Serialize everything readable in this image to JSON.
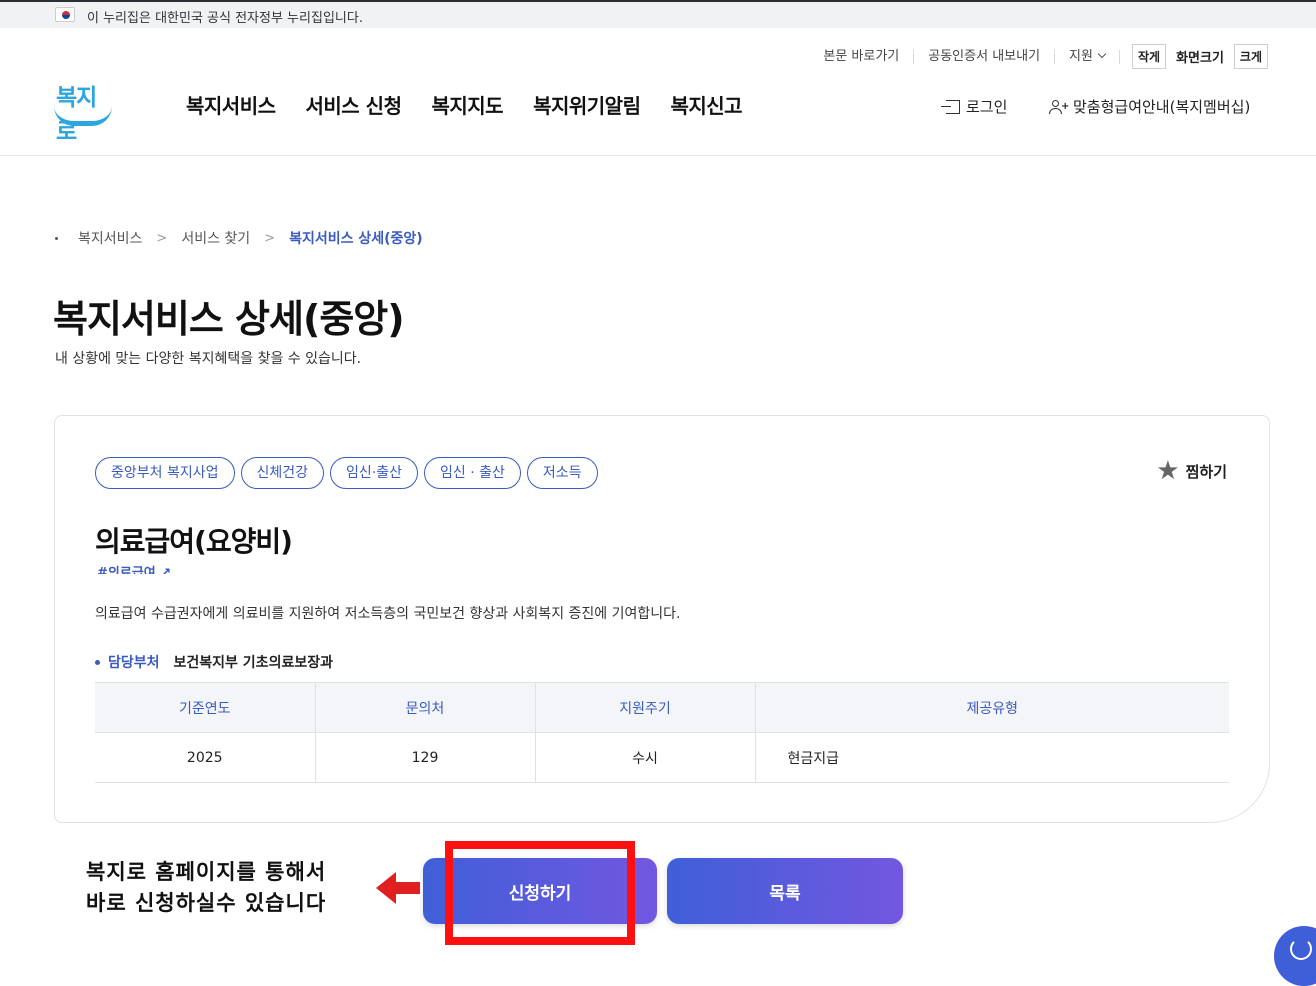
{
  "gov_bar": {
    "text": "이 누리집은 대한민국 공식 전자정부 누리집입니다."
  },
  "utility": {
    "skip": "본문 바로가기",
    "cert": "공동인증서 내보내기",
    "support": "지원",
    "font_small": "작게",
    "font_label": "화면크기",
    "font_large": "크게"
  },
  "logo": {
    "text": "복지로"
  },
  "nav": {
    "items": [
      "복지서비스",
      "서비스 신청",
      "복지지도",
      "복지위기알림",
      "복지신고"
    ],
    "login": "로그인",
    "membership": "맞춤형급여안내(복지멤버십)"
  },
  "breadcrumb": {
    "items": [
      "복지서비스",
      "서비스 찾기",
      "복지서비스 상세(중앙)"
    ],
    "separator": ">"
  },
  "page": {
    "title": "복지서비스 상세(중앙)",
    "description": "내 상황에 맞는 다양한 복지혜택을 찾을 수 있습니다."
  },
  "card": {
    "tags": [
      "중앙부처 복지사업",
      "신체건강",
      "임신·출산",
      "임신 · 출산",
      "저소득"
    ],
    "favorite": "찜하기",
    "title": "의료급여(요양비)",
    "hashtag": "#의료급여",
    "description": "의료급여 수급권자에게 의료비를 지원하여 저소득층의 국민보건 향상과 사회복지 증진에 기여합니다.",
    "dept_label": "담당부처",
    "dept_value": "보건복지부 기초의료보장과",
    "table": {
      "headers": [
        "기준연도",
        "문의처",
        "지원주기",
        "제공유형"
      ],
      "row": [
        "2025",
        "129",
        "수시",
        "현금지급"
      ]
    }
  },
  "buttons": {
    "apply": "신청하기",
    "list": "목록"
  },
  "annotation": {
    "line1": "복지로 홈페이지를 통해서",
    "line2": "바로 신청하실수 있습니다"
  },
  "colors": {
    "accent": "#3a5bbf",
    "highlight": "#ff1010",
    "button_start": "#3f5fd8",
    "button_end": "#7357e0"
  }
}
